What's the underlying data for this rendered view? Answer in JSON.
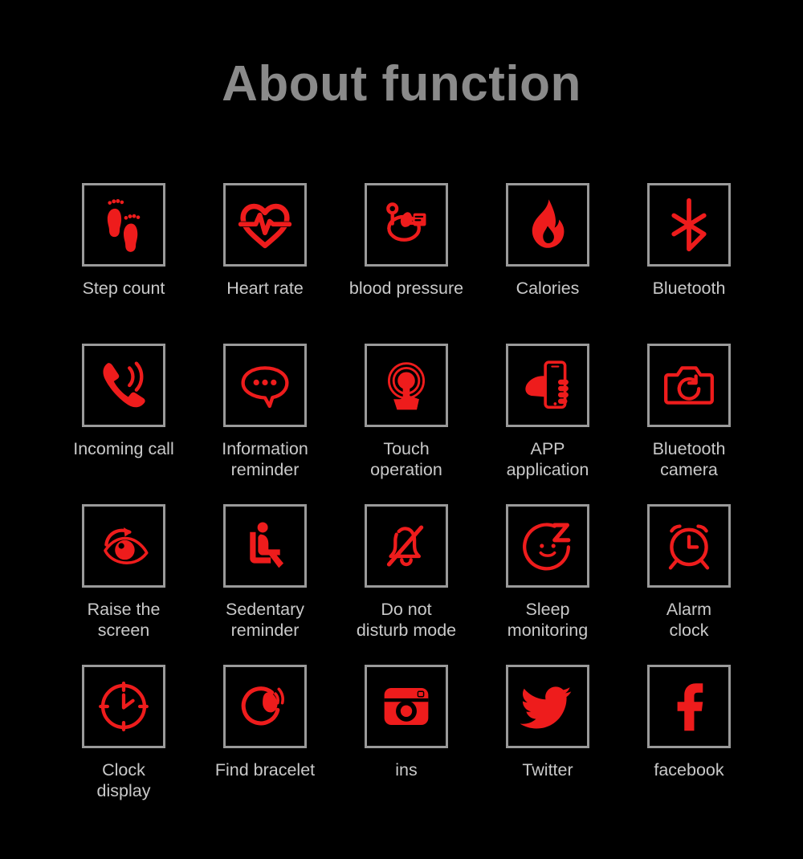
{
  "header": {
    "title": "About function",
    "title_color": "#8a8a8a"
  },
  "theme": {
    "background": "#000000",
    "icon_red": "#ee1c1c",
    "tile_border": "#9a9a9a",
    "label_color": "#c9c9c9"
  },
  "grid": {
    "columns": 5,
    "rows": 4,
    "items": [
      {
        "label": "Step count",
        "icon": "footprints-icon"
      },
      {
        "label": "Heart rate",
        "icon": "heart-pulse-icon"
      },
      {
        "label": "blood pressure",
        "icon": "blood-pressure-monitor-icon"
      },
      {
        "label": "Calories",
        "icon": "flame-icon"
      },
      {
        "label": "Bluetooth",
        "icon": "bluetooth-icon"
      },
      {
        "label": "Incoming call",
        "icon": "phone-ringing-icon"
      },
      {
        "label": "Information\nreminder",
        "icon": "speech-bubble-dots-icon"
      },
      {
        "label": "Touch\noperation",
        "icon": "touch-ripple-icon"
      },
      {
        "label": "APP\napplication",
        "icon": "hand-holding-phone-icon"
      },
      {
        "label": "Bluetooth\ncamera",
        "icon": "camera-icon"
      },
      {
        "label": "Raise the\nscreen",
        "icon": "eye-rotate-icon"
      },
      {
        "label": "Sedentary\nreminder",
        "icon": "seated-person-icon"
      },
      {
        "label": "Do not\ndisturb mode",
        "icon": "bell-muted-icon"
      },
      {
        "label": "Sleep\nmonitoring",
        "icon": "sleeping-face-z-icon"
      },
      {
        "label": "Alarm\nclock",
        "icon": "alarm-clock-icon"
      },
      {
        "label": "Clock\ndisplay",
        "icon": "clock-face-icon"
      },
      {
        "label": "Find bracelet",
        "icon": "bracelet-vibrate-icon"
      },
      {
        "label": "ins",
        "icon": "instagram-icon"
      },
      {
        "label": "Twitter",
        "icon": "twitter-bird-icon"
      },
      {
        "label": "facebook",
        "icon": "facebook-f-icon"
      }
    ]
  }
}
